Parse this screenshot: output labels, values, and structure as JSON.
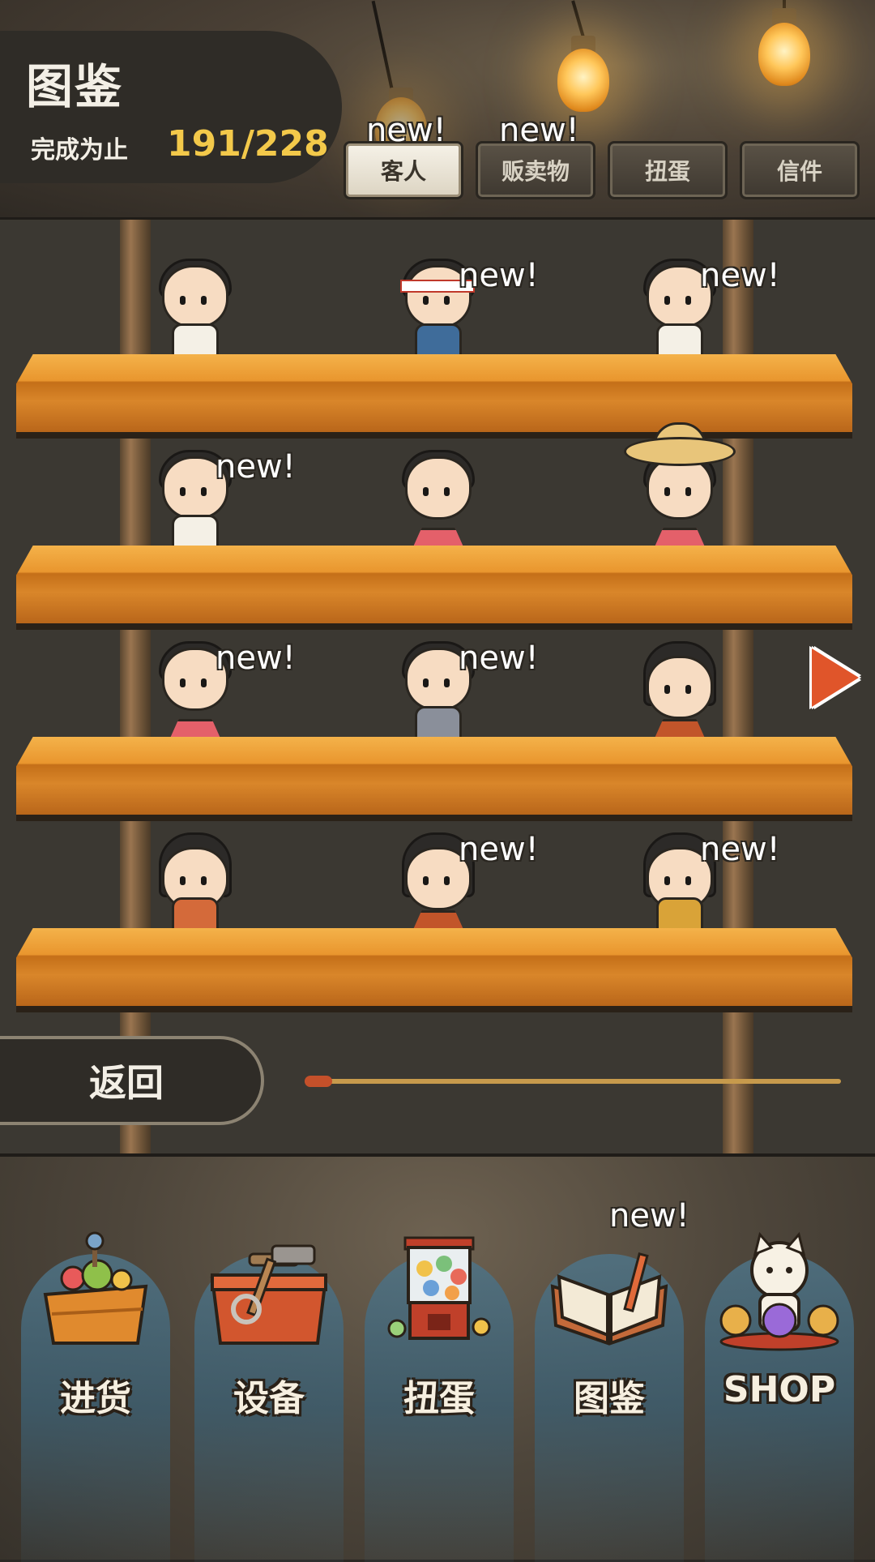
{
  "header": {
    "title": "图鉴",
    "completion_label": "完成为止",
    "completion_value": "191/228",
    "tabs": [
      {
        "label": "客人",
        "new": "new!",
        "active": true
      },
      {
        "label": "贩卖物",
        "new": "new!",
        "active": false
      },
      {
        "label": "扭蛋",
        "new": "",
        "active": false
      },
      {
        "label": "信件",
        "new": "",
        "active": false
      }
    ]
  },
  "shelves": [
    {
      "characters": [
        {
          "new": ""
        },
        {
          "new": "new!"
        },
        {
          "new": "new!"
        }
      ]
    },
    {
      "characters": [
        {
          "new": "new!"
        },
        {
          "new": ""
        },
        {
          "new": ""
        }
      ]
    },
    {
      "characters": [
        {
          "new": "new!"
        },
        {
          "new": "new!"
        },
        {
          "new": ""
        }
      ]
    },
    {
      "characters": [
        {
          "new": ""
        },
        {
          "new": "new!"
        },
        {
          "new": "new!"
        }
      ]
    }
  ],
  "back_label": "返回",
  "scroll_progress": 0.0,
  "nav": [
    {
      "label": "进货",
      "icon": "stock-basket-icon",
      "new": ""
    },
    {
      "label": "设备",
      "icon": "toolbox-icon",
      "new": ""
    },
    {
      "label": "扭蛋",
      "icon": "gacha-machine-icon",
      "new": ""
    },
    {
      "label": "图鉴",
      "icon": "open-book-icon",
      "new": "new!"
    },
    {
      "label": "SHOP",
      "icon": "lucky-cat-icon",
      "new": ""
    }
  ],
  "colors": {
    "accent_yellow": "#f3c94a",
    "arrow_orange": "#e0552a",
    "panel_dark": "#2f2c27"
  }
}
